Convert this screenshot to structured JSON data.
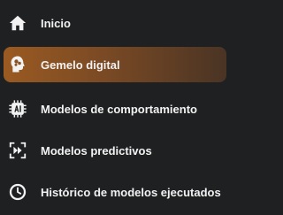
{
  "sidebar": {
    "active_index": 1,
    "items": [
      {
        "label": "Inicio",
        "icon": "home-icon"
      },
      {
        "label": "Gemelo digital",
        "icon": "head-brain-icon"
      },
      {
        "label": "Modelos de comportamiento",
        "icon": "ai-chip-icon"
      },
      {
        "label": "Modelos predictivos",
        "icon": "fast-forward-icon"
      },
      {
        "label": "Histórico de modelos ejecutados",
        "icon": "history-icon"
      }
    ]
  },
  "colors": {
    "background": "#1e2022",
    "text": "#f2f2f2",
    "active_accent": "#9a5a22"
  }
}
